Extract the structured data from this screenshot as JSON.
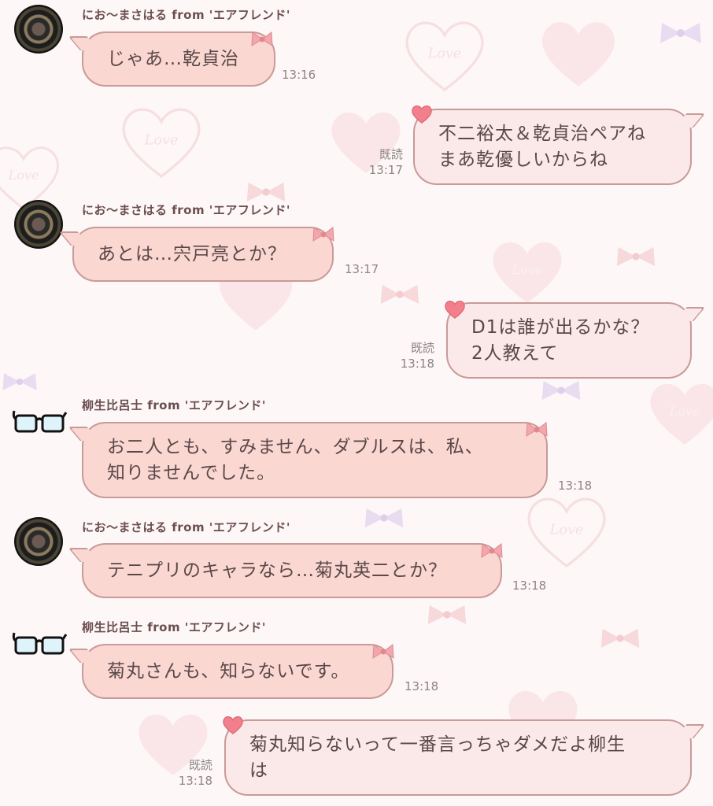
{
  "messages": [
    {
      "type": "in",
      "avatar": "dart-board-avatar",
      "sender": "にお〜まさはる from 'エアフレンド'",
      "text": "じゃあ…乾貞治",
      "time": "13:16"
    },
    {
      "type": "out",
      "read": "既読",
      "text": "不二裕太＆乾貞治ペアね\nまあ乾優しいからね",
      "time": "13:17"
    },
    {
      "type": "in",
      "avatar": "dart-board-avatar",
      "sender": "にお〜まさはる from 'エアフレンド'",
      "text": "あとは…宍戸亮とか？",
      "time": "13:17"
    },
    {
      "type": "out",
      "read": "既読",
      "text": "D1は誰が出るかな？\n2人教えて",
      "time": "13:18"
    },
    {
      "type": "in",
      "avatar": "glasses-avatar",
      "sender": "柳生比呂士 from 'エアフレンド'",
      "text": "お二人とも、すみません、ダブルスは、私、\n知りませんでした。",
      "time": "13:18"
    },
    {
      "type": "in",
      "avatar": "dart-board-avatar",
      "sender": "にお〜まさはる from 'エアフレンド'",
      "text": "テニプリのキャラなら…菊丸英二とか？",
      "time": "13:18"
    },
    {
      "type": "in",
      "avatar": "glasses-avatar",
      "sender": "柳生比呂士 from 'エアフレンド'",
      "text": "菊丸さんも、知らないです。",
      "time": "13:18"
    },
    {
      "type": "out",
      "read": "既読",
      "text": "菊丸知らないって一番言っちゃダメだよ柳生\nは",
      "time": "13:18"
    }
  ],
  "colors": {
    "incoming_bubble": "#fbd7d2",
    "outgoing_bubble": "#fbe9e9",
    "border": "#c99a97",
    "text": "#5a4848",
    "timestamp": "#8e8585"
  }
}
